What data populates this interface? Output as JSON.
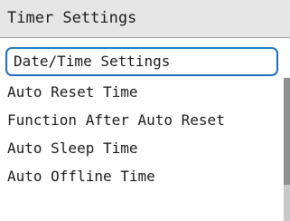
{
  "header": {
    "title": "Timer Settings"
  },
  "menu": {
    "items": [
      {
        "label": "Date/Time Settings",
        "selected": true
      },
      {
        "label": "Auto Reset Time",
        "selected": false
      },
      {
        "label": "Function After Auto Reset",
        "selected": false
      },
      {
        "label": "Auto Sleep Time",
        "selected": false
      },
      {
        "label": "Auto Offline Time",
        "selected": false
      }
    ]
  },
  "colors": {
    "selection_border": "#1f6fc5",
    "header_background": "#e6e6e6",
    "text": "#1a1a1a"
  }
}
